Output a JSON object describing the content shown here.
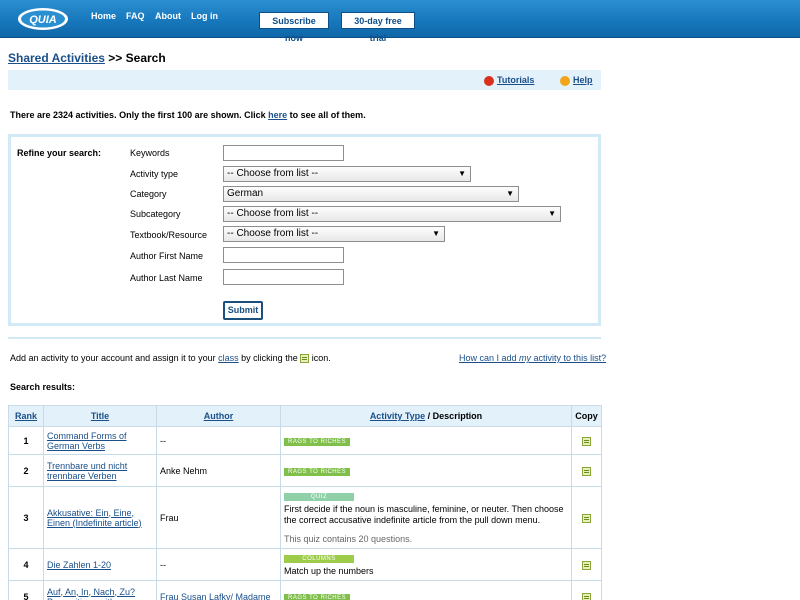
{
  "header": {
    "logo_text": "QUIA",
    "nav": [
      "Home",
      "FAQ",
      "About",
      "Log in"
    ],
    "subscribe_label": "Subscribe now",
    "trial_label": "30-day free trial"
  },
  "breadcrumb": {
    "link": "Shared Activities",
    "sep": ">>",
    "current": "Search"
  },
  "helpbar": {
    "tutorials": "Tutorials",
    "help": "Help"
  },
  "count": {
    "prefix": "There are 2324 activities. Only the first 100 are shown. Click",
    "link": "here",
    "suffix": "to see all of them."
  },
  "refine": {
    "title": "Refine your search:",
    "keywords_label": "Keywords",
    "keywords_value": "",
    "activity_type_label": "Activity type",
    "activity_type_value": "-- Choose from list --",
    "category_label": "Category",
    "category_value": "German",
    "subcategory_label": "Subcategory",
    "subcategory_value": "-- Choose from list --",
    "textbook_label": "Textbook/Resource",
    "textbook_value": "-- Choose from list --",
    "author_first_label": "Author First Name",
    "author_first_value": "",
    "author_last_label": "Author Last Name",
    "author_last_value": "",
    "submit_label": "Submit"
  },
  "add": {
    "prefix": "Add an activity to your account and assign it to your",
    "link": "class",
    "middle": "by clicking the",
    "suffix": "icon.",
    "how_prefix": "How can I add ",
    "how_em": "my",
    "how_suffix": " activity to this list?"
  },
  "results_title": "Search results:",
  "table": {
    "headers": {
      "rank": "Rank",
      "title": "Title",
      "author": "Author",
      "type_link": "Activity Type",
      "type_rest": " / Description",
      "copy": "Copy"
    },
    "rows": [
      {
        "rank": "1",
        "title": "Command Forms of German Verbs",
        "author": "--",
        "type": "RAGS TO RICHES",
        "color": "#7fbf4a",
        "desc": "",
        "note": ""
      },
      {
        "rank": "2",
        "title": "Trennbare und nicht trennbare Verben",
        "author": "Anke Nehm",
        "type": "RAGS TO RICHES",
        "color": "#7fbf4a",
        "desc": "",
        "note": ""
      },
      {
        "rank": "3",
        "title": "Akkusative: Ein, Eine, Einen (Indefinite article)",
        "author": "Frau",
        "type": "QUIZ",
        "color": "#8fd0a8",
        "desc": "First decide if the noun is masculine, feminine, or neuter. Then choose the correct accusative indefinite article from the pull down menu.",
        "note": "This quiz contains 20 questions."
      },
      {
        "rank": "4",
        "title": "Die Zahlen 1-20",
        "author": "--",
        "type": "COLUMNS",
        "color": "#9ccc4a",
        "desc": "Match up the numbers",
        "note": ""
      },
      {
        "rank": "5",
        "title": "Auf, An, In, Nach, Zu? Prepositions with",
        "author": "Frau Susan Lafky/ Madame",
        "type": "RAGS TO RICHES",
        "color": "#7fbf4a",
        "desc": "",
        "note": ""
      }
    ]
  }
}
